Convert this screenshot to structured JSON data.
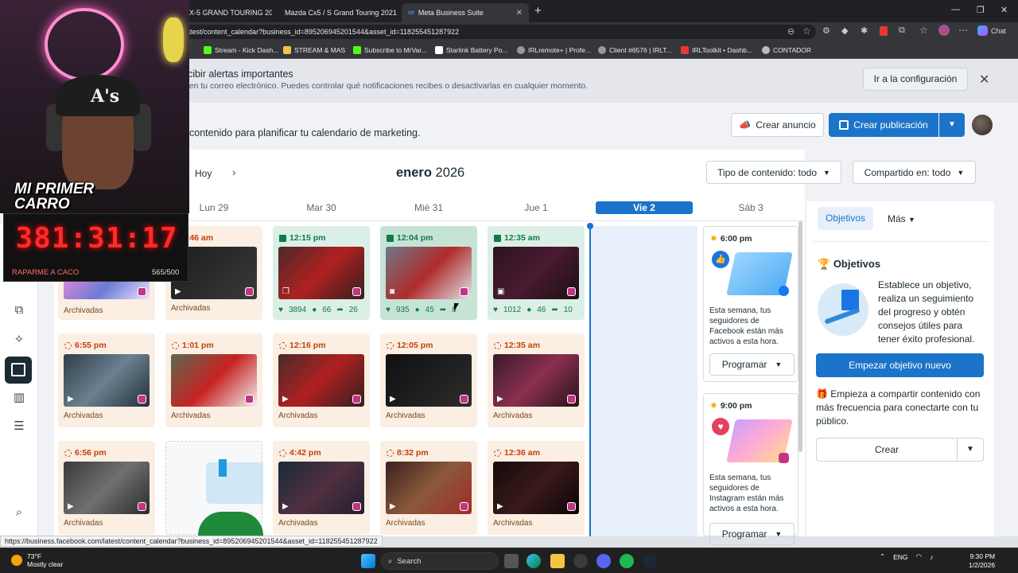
{
  "browser": {
    "tabs": [
      {
        "label": "X-5 GRAND TOURING 20",
        "active": false
      },
      {
        "label": "Mazda Cx5 / S Grand Touring 2021",
        "active": false
      },
      {
        "label": "Meta Business Suite",
        "active": true
      }
    ],
    "new_tab": "+",
    "url": "atest/content_calendar?business_id=895206945201544&asset_id=118255451287922",
    "chat_label": "Chat",
    "bookmarks": [
      "Stream - Kick Dash...",
      "STREAM & MAS",
      "Subscribe to MrVar...",
      "Starlink Battery Po...",
      "IRLremote+ | Profe...",
      "Client #6576 | IRLT...",
      "IRLToolkit • Dashb...",
      "CONTADOR"
    ]
  },
  "alert": {
    "title": "ecibir alertas importantes",
    "text": "e en tu correo electrónico. Puedes controlar qué notificaciones recibes o desactivarlas en cualquier momento.",
    "button": "Ir a la configuración"
  },
  "header": {
    "subtitle": "contenido para planificar tu calendario de marketing.",
    "create_ad": "Crear anuncio",
    "create_post": "Crear publicación"
  },
  "calendar": {
    "today_btn": "Hoy",
    "month": "enero",
    "year": "2026",
    "filter_type": "Tipo de contenido: todo",
    "filter_shared": "Compartido en: todo",
    "days": [
      "Lun 29",
      "Mar 30",
      "Mié 31",
      "Jue 1",
      "Vie 2",
      "Sáb 3"
    ],
    "row1": [
      {
        "time": "",
        "label": "Archivadas"
      },
      {
        "time": "1:46 am",
        "label": "Archivadas"
      },
      {
        "time": "12:15 pm",
        "likes": "3894",
        "comments": "66",
        "shares": "26"
      },
      {
        "time": "12:04 pm",
        "likes": "935",
        "comments": "45",
        "shares": "8"
      },
      {
        "time": "12:35 am",
        "likes": "1012",
        "comments": "46",
        "shares": "10"
      }
    ],
    "row2": [
      {
        "time": "6:55 pm",
        "label": "Archivadas"
      },
      {
        "time": "1:01 pm",
        "label": "Archivadas"
      },
      {
        "time": "12:16 pm",
        "label": "Archivadas"
      },
      {
        "time": "12:05 pm",
        "label": "Archivadas"
      },
      {
        "time": "12:35 am",
        "label": "Archivadas"
      }
    ],
    "row3": [
      {
        "time": "6:56 pm",
        "label": "Archivadas"
      },
      {
        "time": "4:42 pm",
        "label": "Archivadas"
      },
      {
        "time": "8:32 pm",
        "label": "Archivadas"
      },
      {
        "time": "12:36 am",
        "label": "Archivadas"
      }
    ],
    "tips": [
      {
        "time": "6:00 pm",
        "text": "Esta semana, tus seguidores de Facebook están más activos a esta hora.",
        "button": "Programar"
      },
      {
        "time": "9:00 pm",
        "text": "Esta semana, tus seguidores de Instagram están más activos a esta hora.",
        "button": "Programar"
      }
    ]
  },
  "right_panel": {
    "tab_objetivos": "Objetivos",
    "tab_mas": "Más",
    "title": "Objetivos",
    "text": "Establece un objetivo, realiza un seguimiento del progreso y obtén consejos útiles para tener éxito profesional.",
    "primary_btn": "Empezar objetivo nuevo",
    "share_text": "Empieza a compartir contenido con más frecuencia para conectarte con tu público.",
    "create_btn": "Crear"
  },
  "overlay": {
    "cam_text": "MI PRIMER CARRO",
    "timer": "381:31:17",
    "label": "RAPARME A CACO",
    "count": "565/500"
  },
  "status_link": "https://business.facebook.com/latest/content_calendar?business_id=895206945201544&asset_id=118255451287922",
  "taskbar": {
    "temp": "73°F",
    "weather": "Mostly clear",
    "search": "Search",
    "lang": "ENG",
    "time": "9:30 PM",
    "date": "1/2/2026"
  }
}
